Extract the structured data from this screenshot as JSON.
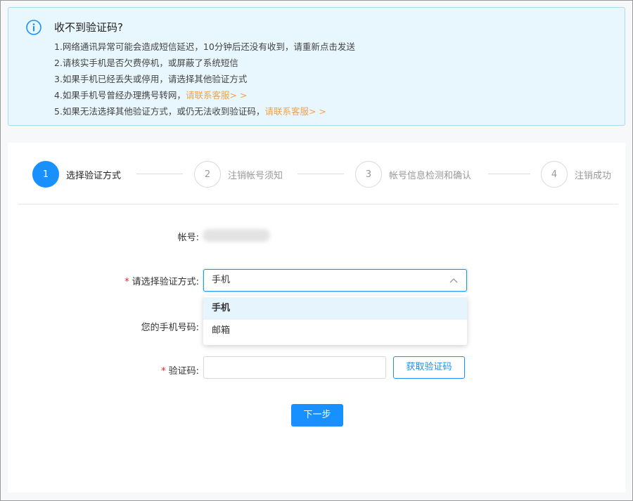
{
  "notice": {
    "title": "收不到验证码?",
    "lines": [
      {
        "text": "1.网络通讯异常可能会造成短信延迟，10分钟后还没有收到，请重新点击发送",
        "link": ""
      },
      {
        "text": "2.请核实手机是否欠费停机，或屏蔽了系统短信",
        "link": ""
      },
      {
        "text": "3.如果手机已经丢失或停用，请选择其他验证方式",
        "link": ""
      },
      {
        "text": "4.如果手机号曾经办理携号转网，",
        "link": "请联系客服> >"
      },
      {
        "text": "5.如果无法选择其他验证方式，或仍无法收到验证码，",
        "link": "请联系客服> >"
      }
    ]
  },
  "steps": [
    {
      "number": "1",
      "label": "选择验证方式",
      "active": true
    },
    {
      "number": "2",
      "label": "注销帐号须知",
      "active": false
    },
    {
      "number": "3",
      "label": "帐号信息检测和确认",
      "active": false
    },
    {
      "number": "4",
      "label": "注销成功",
      "active": false
    }
  ],
  "form": {
    "account_label": "帐号:",
    "method_label": "请选择验证方式:",
    "method_value": "手机",
    "method_options": [
      "手机",
      "邮箱"
    ],
    "phone_label": "您的手机号码:",
    "code_label": "验证码:",
    "code_value": "",
    "get_code_button": "获取验证码",
    "next_button": "下一步"
  },
  "colors": {
    "accent": "#1890ff",
    "link": "#f0a347",
    "required": "#f5222d",
    "notice_bg": "#e8f6fd"
  }
}
